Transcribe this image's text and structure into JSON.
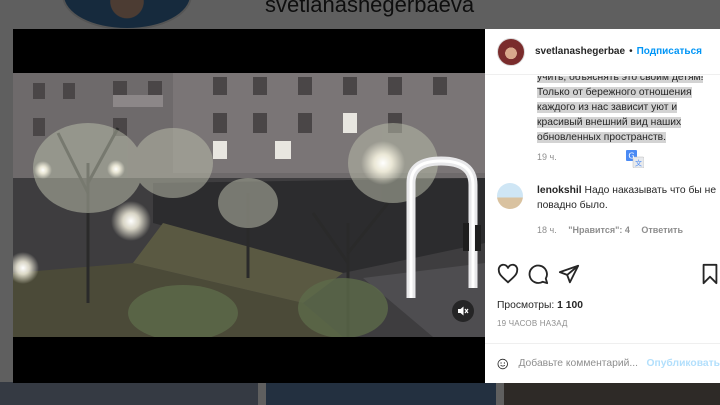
{
  "background": {
    "username": "svetlanashegerbaeva"
  },
  "post": {
    "author": "svetlanashegerbae",
    "separator": "•",
    "follow_label": "Подписаться",
    "caption": "учить, объяснять это своим детям! Только от бережного отношения каждого из нас зависит уют и красивый внешний вид наших обновленных пространств.",
    "caption_time": "19 ч.",
    "views_label": "Просмотры:",
    "views_count": "1 100",
    "posted_ago": "19 ЧАСОВ НАЗАД"
  },
  "comments": [
    {
      "username": "lenokshil",
      "text": "Надо наказывать что бы не повадно было.",
      "time": "18 ч.",
      "likes_label": "\"Нравится\": 4",
      "reply_label": "Ответить"
    }
  ],
  "add_comment": {
    "placeholder": "Добавьте комментарий...",
    "post_label": "Опубликовать"
  },
  "icons": {
    "like": "heart-icon",
    "comment": "comment-icon",
    "share": "paper-plane-icon",
    "save": "bookmark-icon",
    "mute": "speaker-muted-icon",
    "translate": "translate-icon",
    "emoji": "smiley-icon"
  },
  "colors": {
    "link_blue": "#0095f6",
    "post_disabled": "#b2dffc",
    "text": "#262626",
    "secondary": "#8e8e8e"
  }
}
